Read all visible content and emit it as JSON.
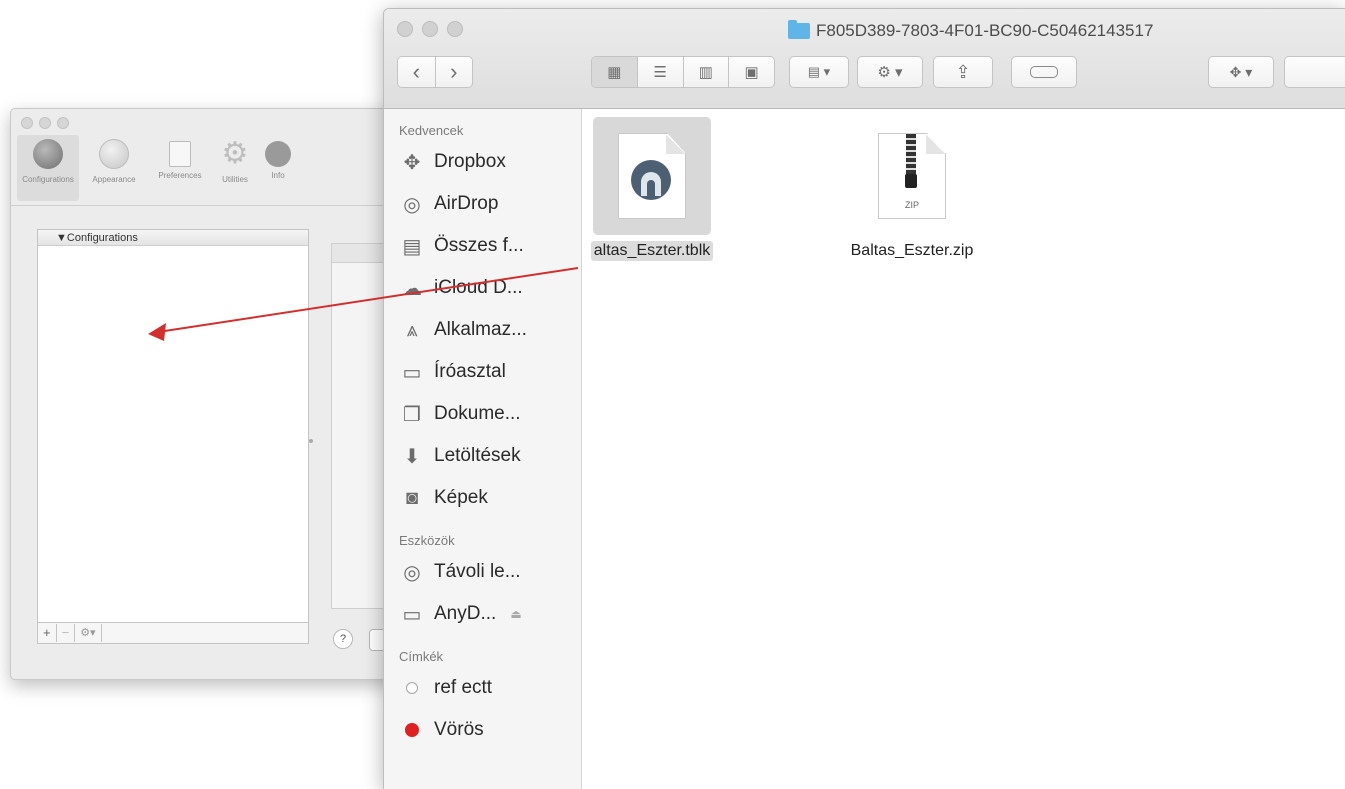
{
  "tunnelblick": {
    "toolbar": [
      {
        "label": "Configurations",
        "icon": "globe-icon"
      },
      {
        "label": "Appearance",
        "icon": "appearance-icon"
      },
      {
        "label": "Preferences",
        "icon": "preferences-icon"
      },
      {
        "label": "Utilities",
        "icon": "gear-icon"
      },
      {
        "label": "Info",
        "icon": "info-icon"
      }
    ],
    "list_header": "▼Configurations",
    "bottom_controls": [
      "+",
      "−",
      "⚙▾"
    ],
    "help": "?"
  },
  "finder": {
    "title": "F805D389-7803-4F01-BC90-C50462143517",
    "nav": {
      "back": "‹",
      "forward": "›"
    },
    "sidebar": {
      "favorites_header": "Kedvencek",
      "favorites": [
        {
          "label": "Dropbox",
          "icon": "dropbox-icon"
        },
        {
          "label": "AirDrop",
          "icon": "airdrop-icon"
        },
        {
          "label": "Összes f...",
          "icon": "all-files-icon"
        },
        {
          "label": "iCloud D...",
          "icon": "icloud-icon"
        },
        {
          "label": "Alkalmaz...",
          "icon": "applications-icon"
        },
        {
          "label": "Íróasztal",
          "icon": "desktop-icon"
        },
        {
          "label": "Dokume...",
          "icon": "documents-icon"
        },
        {
          "label": "Letöltések",
          "icon": "downloads-icon"
        },
        {
          "label": "Képek",
          "icon": "pictures-icon"
        }
      ],
      "devices_header": "Eszközök",
      "devices": [
        {
          "label": "Távoli le...",
          "icon": "remote-disc-icon"
        },
        {
          "label": "AnyD...",
          "icon": "drive-icon",
          "eject": "⏏"
        }
      ],
      "tags_header": "Címkék",
      "tags": [
        {
          "label": "ref ectt",
          "color": "#ffffff"
        },
        {
          "label": "Vörös",
          "color": "#e0201e"
        }
      ]
    },
    "files": [
      {
        "name": "altas_Eszter.tblk",
        "icon": "tunnelblick-file-icon",
        "selected": true
      },
      {
        "name": "Baltas_Eszter.zip",
        "icon": "zip-file-icon",
        "badge": "ZIP",
        "selected": false
      }
    ]
  },
  "colors": {
    "drag_arrow": "#d32f2f",
    "folder_blue": "#5fb5e8"
  }
}
